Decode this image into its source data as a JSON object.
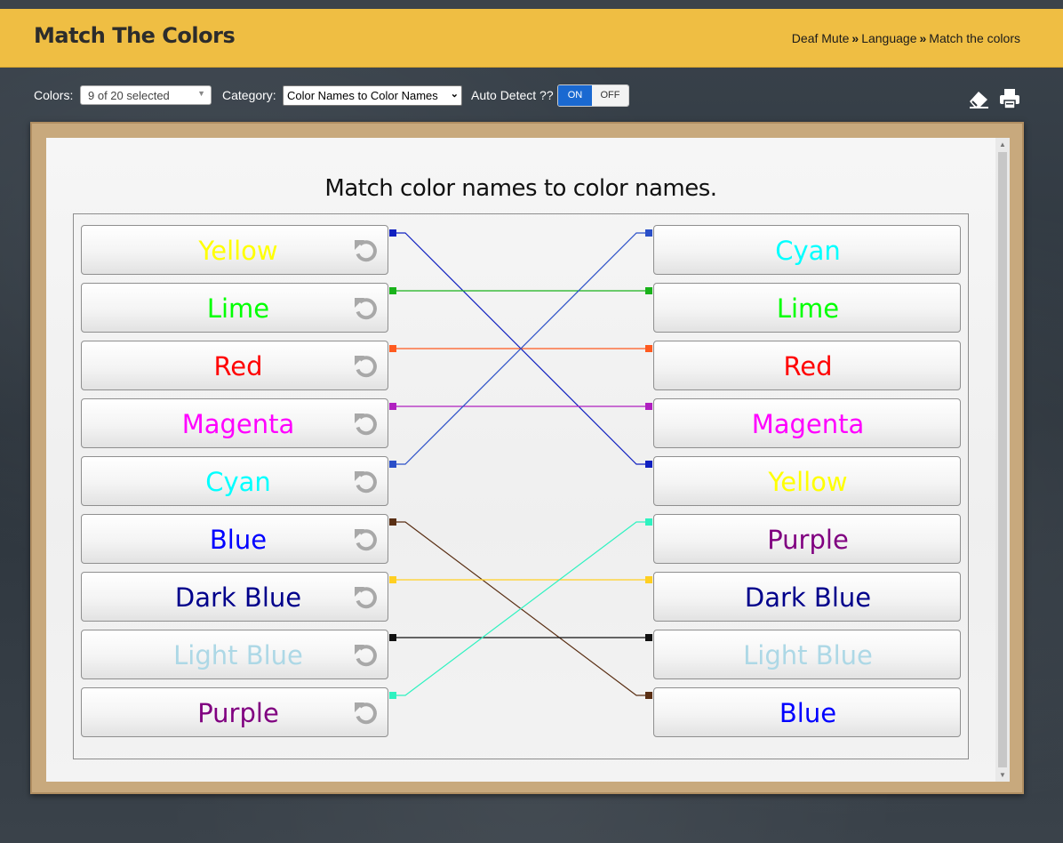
{
  "header": {
    "title": "Match The Colors",
    "breadcrumb": [
      "Deaf Mute",
      "Language",
      "Match the colors"
    ],
    "separator": "»"
  },
  "controls": {
    "colors_label": "Colors:",
    "colors_value": "9 of 20 selected",
    "category_label": "Category:",
    "category_value": "Color Names to Color Names",
    "auto_detect_label": "Auto Detect ??",
    "toggle_on": "ON",
    "toggle_off": "OFF",
    "toggle_state": "ON"
  },
  "toolbar": {
    "icons": [
      "eraser-icon",
      "printer-icon"
    ]
  },
  "worksheet": {
    "title": "Match color names to color names.",
    "left_items": [
      {
        "label": "Yellow",
        "color": "#ffff00"
      },
      {
        "label": "Lime",
        "color": "#00ff00"
      },
      {
        "label": "Red",
        "color": "#ff0000"
      },
      {
        "label": "Magenta",
        "color": "#ff00ff"
      },
      {
        "label": "Cyan",
        "color": "#00ffff"
      },
      {
        "label": "Blue",
        "color": "#0000ff"
      },
      {
        "label": "Dark Blue",
        "color": "#00008b"
      },
      {
        "label": "Light Blue",
        "color": "#add8e6"
      },
      {
        "label": "Purple",
        "color": "#800080"
      }
    ],
    "right_items": [
      {
        "label": "Cyan",
        "color": "#00ffff"
      },
      {
        "label": "Lime",
        "color": "#00ff00"
      },
      {
        "label": "Red",
        "color": "#ff0000"
      },
      {
        "label": "Magenta",
        "color": "#ff00ff"
      },
      {
        "label": "Yellow",
        "color": "#ffff00"
      },
      {
        "label": "Purple",
        "color": "#800080"
      },
      {
        "label": "Dark Blue",
        "color": "#00008b"
      },
      {
        "label": "Light Blue",
        "color": "#add8e6"
      },
      {
        "label": "Blue",
        "color": "#0000ff"
      }
    ],
    "connections": [
      {
        "from": 0,
        "to": 4,
        "line_color": "#1020c0"
      },
      {
        "from": 1,
        "to": 1,
        "line_color": "#19b21a"
      },
      {
        "from": 2,
        "to": 2,
        "line_color": "#ff5a1f"
      },
      {
        "from": 3,
        "to": 3,
        "line_color": "#b020c0"
      },
      {
        "from": 4,
        "to": 0,
        "line_color": "#2a4fc8"
      },
      {
        "from": 5,
        "to": 8,
        "line_color": "#5a2f14"
      },
      {
        "from": 6,
        "to": 6,
        "line_color": "#ffcf22"
      },
      {
        "from": 7,
        "to": 7,
        "line_color": "#111111"
      },
      {
        "from": 8,
        "to": 5,
        "line_color": "#2ef2c0"
      }
    ]
  }
}
